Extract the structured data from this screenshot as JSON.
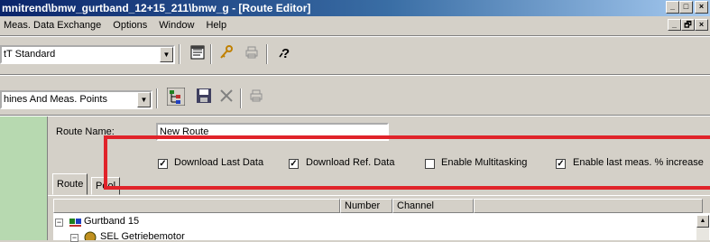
{
  "window": {
    "title": "mnitrend\\bmw_gurtband_12+15_211\\bmw_g - [Route Editor]",
    "caption_buttons": [
      "_",
      "□",
      "×"
    ],
    "mdi_buttons": [
      "_",
      "🗗",
      "×"
    ]
  },
  "menu": {
    "items": [
      {
        "label": "Meas. Data Exchange"
      },
      {
        "label": "Options"
      },
      {
        "label": "Window"
      },
      {
        "label": "Help"
      }
    ]
  },
  "toolbar1": {
    "combo_value": "tT Standard",
    "icons": [
      "notepad-icon",
      "key-icon",
      "printer-icon",
      "help-icon"
    ]
  },
  "toolbar2": {
    "combo_value": "hines And Meas. Points",
    "icons": [
      "tree-icon",
      "save-icon",
      "delete-icon",
      "printer-icon"
    ]
  },
  "form": {
    "route_name_label": "Route Name:",
    "route_name_value": "New Route",
    "checkboxes": [
      {
        "label": "Download Last Data",
        "checked": true
      },
      {
        "label": "Download Ref. Data",
        "checked": true
      },
      {
        "label": "Enable Multitasking",
        "checked": false
      },
      {
        "label": "Enable last meas. % increase",
        "checked": true
      }
    ],
    "tabs": [
      {
        "label": "Route",
        "active": true
      },
      {
        "label": "Pool",
        "active": false
      }
    ]
  },
  "list": {
    "columns": [
      "Number",
      "Channel"
    ],
    "tree": [
      {
        "label": "Gurtband 15",
        "expanded": true
      },
      {
        "label": "SEL Getriebemotor",
        "expanded": true
      }
    ]
  },
  "colors": {
    "highlight_box": "#e0232a",
    "titlebar": "#0a246a",
    "side_panel": "#b7d9b0"
  }
}
